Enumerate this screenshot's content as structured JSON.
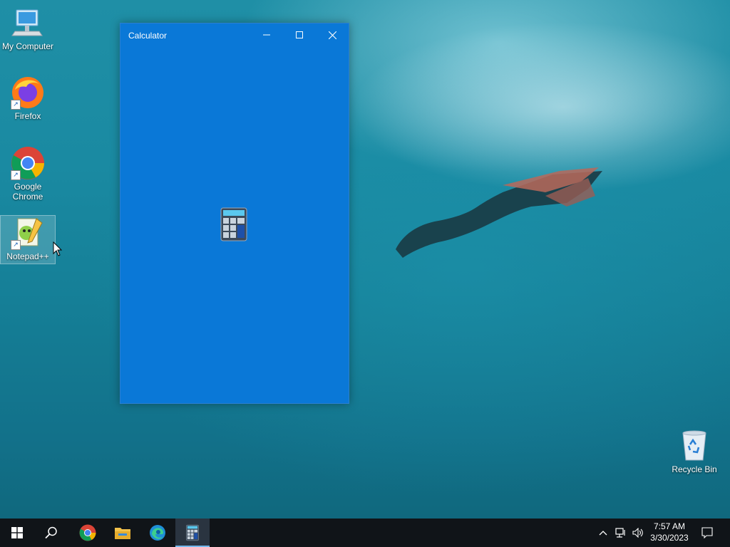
{
  "desktop": {
    "icons": [
      {
        "label": "My Computer"
      },
      {
        "label": "Firefox"
      },
      {
        "label": "Google Chrome"
      },
      {
        "label": "Notepad++"
      },
      {
        "label": "Recycle Bin"
      }
    ]
  },
  "window": {
    "title": "Calculator",
    "background": "#0a78d7"
  },
  "taskbar": {
    "pinned": [
      "start-icon",
      "search-icon",
      "chrome-icon",
      "file-explorer-icon",
      "edge-icon",
      "calculator-icon"
    ],
    "active": "calculator-icon",
    "clock": {
      "time": "7:57 AM",
      "date": "3/30/2023"
    }
  }
}
